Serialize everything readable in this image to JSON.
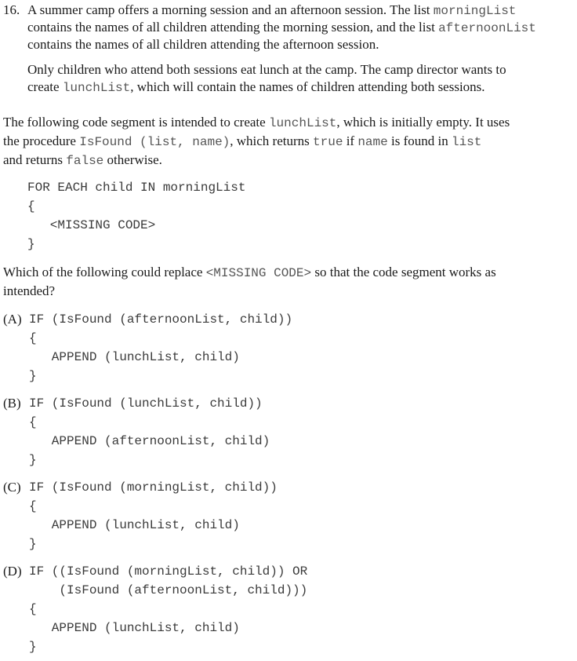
{
  "question": {
    "number": "16.",
    "stem_lines": [
      [
        "A summer camp offers a morning session and an afternoon session. The list ",
        {
          "code": "morningList"
        }
      ],
      [
        "contains the names of all children attending the morning session, and the list ",
        {
          "code": "afternoonList"
        }
      ],
      [
        "contains the names of all children attending the afternoon session."
      ]
    ],
    "para2_lines": [
      [
        "Only children who attend both sessions eat lunch at the camp. The camp director wants to"
      ],
      [
        "create ",
        {
          "code": "lunchList"
        },
        ", which will contain the names of children attending both sessions."
      ]
    ],
    "para3_lines": [
      [
        "The following code segment is intended to create ",
        {
          "code": "lunchList"
        },
        ", which is initially empty. It uses"
      ],
      [
        "the procedure ",
        {
          "code": "IsFound (list, name)"
        },
        ", which returns ",
        {
          "code": "true"
        },
        " if ",
        {
          "code": "name"
        },
        " is found in ",
        {
          "code": "list"
        }
      ],
      [
        "and returns ",
        {
          "code": "false"
        },
        " otherwise."
      ]
    ],
    "code_segment": [
      "FOR EACH child IN morningList",
      "{",
      "   <MISSING CODE>",
      "}"
    ],
    "prompt_lines": [
      [
        "Which of the following could replace ",
        {
          "code": "<MISSING CODE>"
        },
        " so that the code segment works as"
      ],
      [
        "intended?"
      ]
    ],
    "options": [
      {
        "label": "(A)",
        "lines": [
          "IF (IsFound (afternoonList, child))",
          "{",
          "   APPEND (lunchList, child)",
          "}"
        ]
      },
      {
        "label": "(B)",
        "lines": [
          "IF (IsFound (lunchList, child))",
          "{",
          "   APPEND (afternoonList, child)",
          "}"
        ]
      },
      {
        "label": "(C)",
        "lines": [
          "IF (IsFound (morningList, child))",
          "{",
          "   APPEND (lunchList, child)",
          "}"
        ]
      },
      {
        "label": "(D)",
        "lines": [
          "IF ((IsFound (morningList, child)) OR",
          "    (IsFound (afternoonList, child)))",
          "{",
          "   APPEND (lunchList, child)",
          "}"
        ]
      }
    ]
  }
}
